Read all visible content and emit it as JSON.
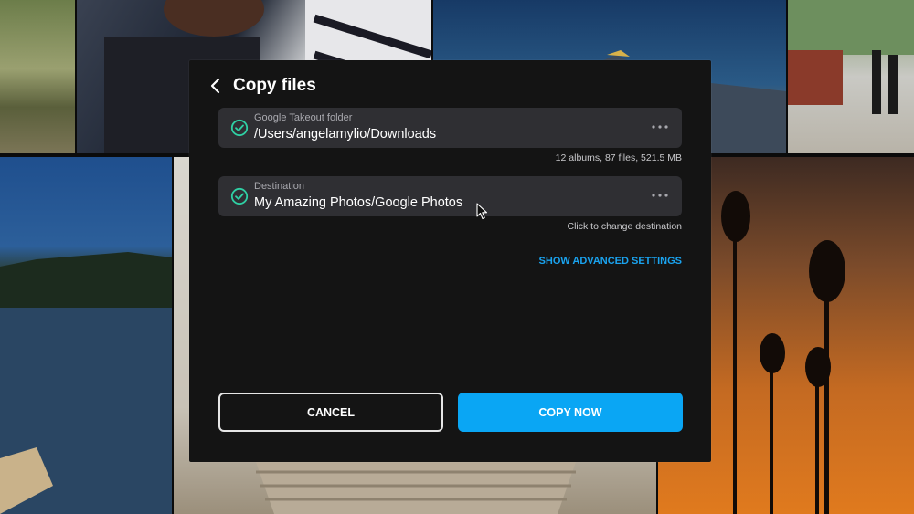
{
  "dialog": {
    "title": "Copy files",
    "source": {
      "label": "Google Takeout folder",
      "value": "/Users/angelamylio/Downloads",
      "info": "12 albums, 87 files, 521.5 MB"
    },
    "destination": {
      "label": "Destination",
      "value": "My Amazing Photos/Google Photos",
      "hint": "Click to change destination"
    },
    "advanced_label": "SHOW ADVANCED SETTINGS",
    "cancel_label": "CANCEL",
    "copy_label": "COPY NOW"
  },
  "colors": {
    "accent": "#0aa6f4",
    "success": "#2fd0a4",
    "dialog_bg": "#141414",
    "field_bg": "#2f2f33"
  },
  "icons": [
    "back-arrow-icon",
    "check-circle-icon",
    "more-dots-icon",
    "mouse-cursor-icon"
  ]
}
